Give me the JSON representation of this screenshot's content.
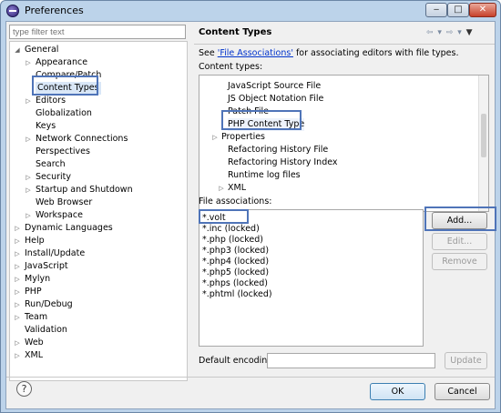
{
  "window": {
    "title": "Preferences"
  },
  "filter": {
    "placeholder": "type filter text"
  },
  "tree": [
    {
      "label": "General",
      "expanded": true,
      "level": 0
    },
    {
      "label": "Appearance",
      "expandable": true,
      "level": 1
    },
    {
      "label": "Compare/Patch",
      "level": 1
    },
    {
      "label": "Content Types",
      "level": 1,
      "selected": true
    },
    {
      "label": "Editors",
      "expandable": true,
      "level": 1
    },
    {
      "label": "Globalization",
      "level": 1
    },
    {
      "label": "Keys",
      "level": 1
    },
    {
      "label": "Network Connections",
      "expandable": true,
      "level": 1
    },
    {
      "label": "Perspectives",
      "level": 1
    },
    {
      "label": "Search",
      "level": 1
    },
    {
      "label": "Security",
      "expandable": true,
      "level": 1
    },
    {
      "label": "Startup and Shutdown",
      "expandable": true,
      "level": 1
    },
    {
      "label": "Web Browser",
      "level": 1
    },
    {
      "label": "Workspace",
      "expandable": true,
      "level": 1
    },
    {
      "label": "Dynamic Languages",
      "expandable": true,
      "level": 0
    },
    {
      "label": "Help",
      "expandable": true,
      "level": 0
    },
    {
      "label": "Install/Update",
      "expandable": true,
      "level": 0
    },
    {
      "label": "JavaScript",
      "expandable": true,
      "level": 0
    },
    {
      "label": "Mylyn",
      "expandable": true,
      "level": 0
    },
    {
      "label": "PHP",
      "expandable": true,
      "level": 0
    },
    {
      "label": "Run/Debug",
      "expandable": true,
      "level": 0
    },
    {
      "label": "Team",
      "expandable": true,
      "level": 0
    },
    {
      "label": "Validation",
      "level": 0
    },
    {
      "label": "Web",
      "expandable": true,
      "level": 0
    },
    {
      "label": "XML",
      "expandable": true,
      "level": 0
    }
  ],
  "page": {
    "title": "Content Types",
    "description_prefix": "See ",
    "description_link": "'File Associations'",
    "description_suffix": " for associating editors with file types.",
    "content_types_label": "Content types:",
    "content_types": [
      {
        "label": "JavaScript Source File",
        "level": 1
      },
      {
        "label": "JS Object Notation File",
        "level": 1
      },
      {
        "label": "Patch File",
        "level": 1
      },
      {
        "label": "PHP Content Type",
        "level": 1,
        "selected": true
      },
      {
        "label": "Properties",
        "level": 0,
        "expandable": true
      },
      {
        "label": "Refactoring History File",
        "level": 1
      },
      {
        "label": "Refactoring History Index",
        "level": 1
      },
      {
        "label": "Runtime log files",
        "level": 1
      },
      {
        "label": "XML",
        "level": 1,
        "expandable": true
      }
    ],
    "file_associations_label": "File associations:",
    "file_associations": [
      "*.volt",
      "*.inc (locked)",
      "*.php (locked)",
      "*.php3 (locked)",
      "*.php4 (locked)",
      "*.php5 (locked)",
      "*.phps (locked)",
      "*.phtml (locked)"
    ],
    "add_button": "Add...",
    "edit_button": "Edit...",
    "remove_button": "Remove",
    "default_encoding_label": "Default encoding:",
    "default_encoding_value": "",
    "update_button": "Update"
  },
  "footer": {
    "ok_button": "OK",
    "cancel_button": "Cancel"
  },
  "icons": {
    "app": "eclipse-icon",
    "help": "help-icon",
    "back": "back-arrow-icon",
    "forward": "forward-arrow-icon",
    "menu": "view-menu-icon"
  },
  "colors": {
    "highlight_border": "#4f74b8",
    "link": "#0033cc",
    "window_frame": "#bcd3ea"
  }
}
